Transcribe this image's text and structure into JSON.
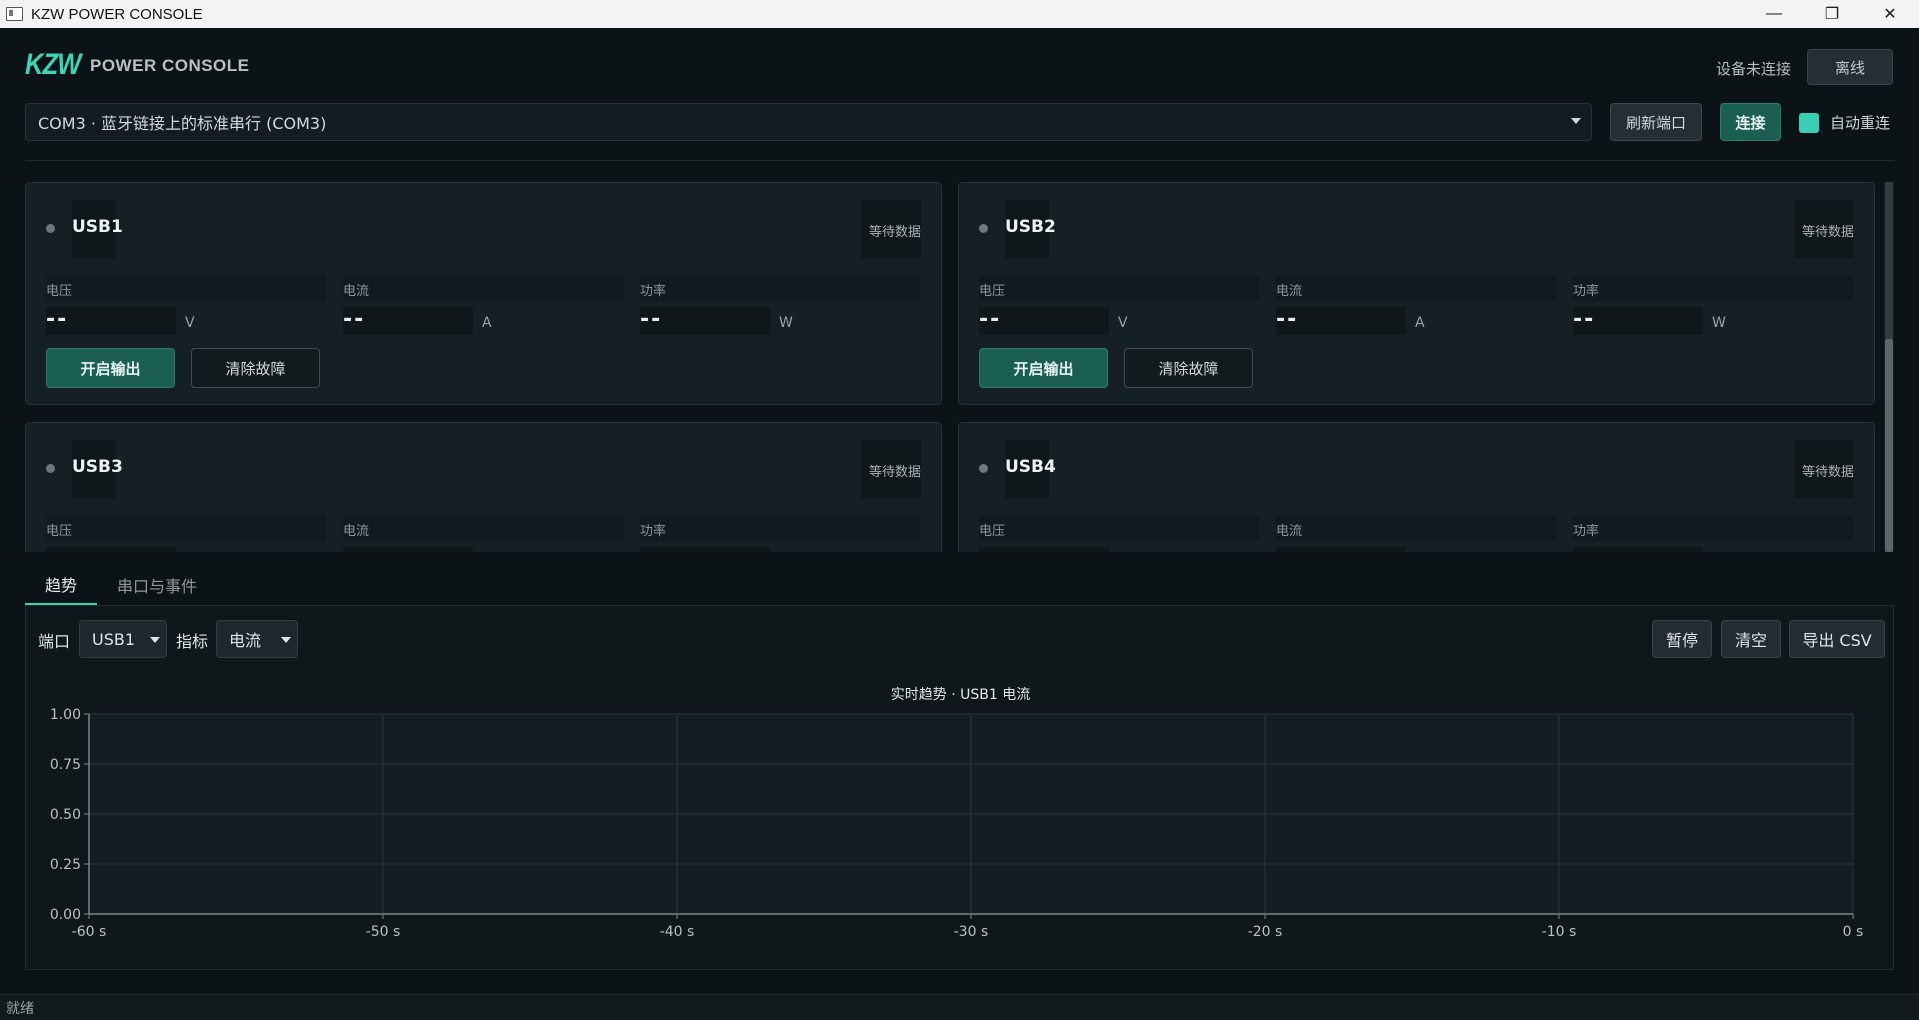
{
  "window": {
    "title": "KZW POWER CONSOLE",
    "minimize_icon": "minimize-icon",
    "maximize_icon": "restore-icon",
    "close_icon": "close-icon"
  },
  "header": {
    "logo": "KZW",
    "brand": "POWER CONSOLE",
    "connection_status": "设备未连接",
    "offline_label": "离线"
  },
  "connection": {
    "port_value": "COM3 · 蓝牙链接上的标准串行 (COM3)",
    "refresh_label": "刷新端口",
    "connect_label": "连接",
    "auto_reconnect_label": "自动重连",
    "auto_reconnect_checked": true
  },
  "cards": [
    {
      "name": "USB1",
      "status": "等待数据",
      "voltage_label": "电压",
      "voltage": "--",
      "voltage_unit": "V",
      "current_label": "电流",
      "current": "--",
      "current_unit": "A",
      "power_label": "功率",
      "power": "--",
      "power_unit": "W",
      "enable_label": "开启输出",
      "clear_label": "清除故障"
    },
    {
      "name": "USB2",
      "status": "等待数据",
      "voltage_label": "电压",
      "voltage": "--",
      "voltage_unit": "V",
      "current_label": "电流",
      "current": "--",
      "current_unit": "A",
      "power_label": "功率",
      "power": "--",
      "power_unit": "W",
      "enable_label": "开启输出",
      "clear_label": "清除故障"
    },
    {
      "name": "USB3",
      "status": "等待数据",
      "voltage_label": "电压",
      "current_label": "电流",
      "power_label": "功率"
    },
    {
      "name": "USB4",
      "status": "等待数据",
      "voltage_label": "电压",
      "current_label": "电流",
      "power_label": "功率"
    }
  ],
  "tabs": [
    {
      "label": "趋势",
      "active": true
    },
    {
      "label": "串口与事件",
      "active": false
    }
  ],
  "trend": {
    "port_label": "端口",
    "port_value": "USB1",
    "metric_label": "指标",
    "metric_value": "电流",
    "pause_label": "暂停",
    "clear_label": "清空",
    "export_label": "导出 CSV"
  },
  "chart_data": {
    "type": "line",
    "title": "实时趋势 · USB1 电流",
    "xlabel": "",
    "ylabel": "",
    "x_ticks": [
      "-60 s",
      "-50 s",
      "-40 s",
      "-30 s",
      "-20 s",
      "-10 s",
      "0 s"
    ],
    "y_ticks": [
      "0.00",
      "0.25",
      "0.50",
      "0.75",
      "1.00"
    ],
    "xlim": [
      -60,
      0
    ],
    "ylim": [
      0,
      1
    ],
    "grid": true,
    "series": []
  },
  "statusbar": {
    "text": "就绪"
  },
  "colors": {
    "accent": "#3ed2b7",
    "primary_button": "#1b5e52",
    "background": "#0c1317",
    "card": "#152024"
  }
}
